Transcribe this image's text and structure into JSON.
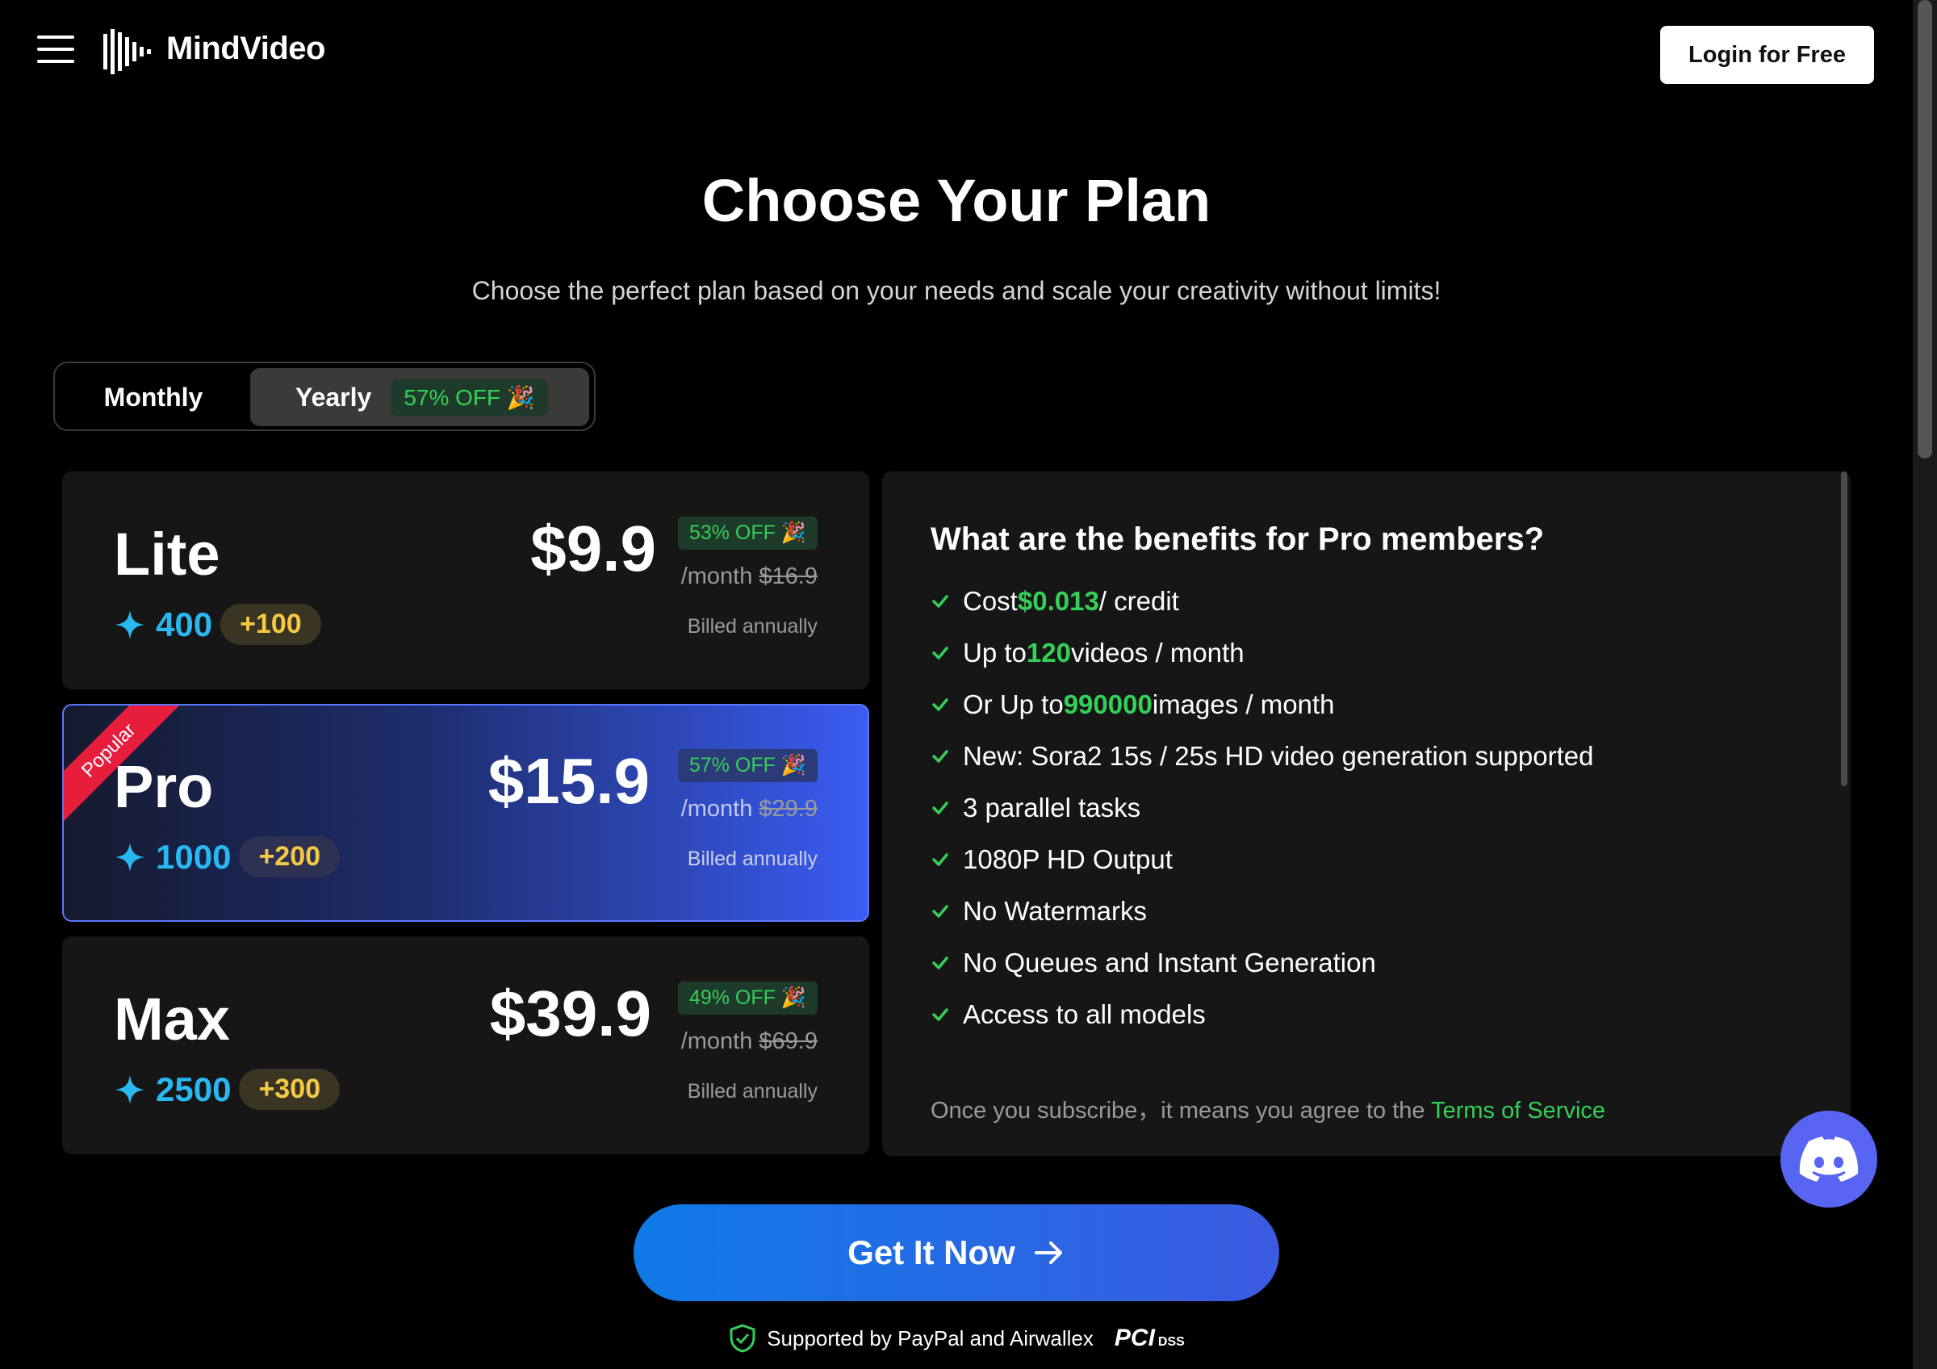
{
  "header": {
    "brand": "MindVideo",
    "login_label": "Login for Free"
  },
  "hero": {
    "title": "Choose Your Plan",
    "subtitle": "Choose the perfect plan based on your needs and scale your creativity without limits!"
  },
  "billing_toggle": {
    "monthly_label": "Monthly",
    "yearly_label": "Yearly",
    "yearly_badge": "57% OFF 🎉",
    "selected": "Yearly"
  },
  "plans": [
    {
      "name": "Lite",
      "credits": "400",
      "bonus": "+100",
      "price": "$9.9",
      "off": "53% OFF 🎉",
      "per": "/month",
      "old_price": "$16.9",
      "billed": "Billed annually"
    },
    {
      "name": "Pro",
      "credits": "1000",
      "bonus": "+200",
      "price": "$15.9",
      "off": "57% OFF 🎉",
      "per": "/month",
      "old_price": "$29.9",
      "billed": "Billed annually",
      "ribbon": "Popular"
    },
    {
      "name": "Max",
      "credits": "2500",
      "bonus": "+300",
      "price": "$39.9",
      "off": "49% OFF 🎉",
      "per": "/month",
      "old_price": "$69.9",
      "billed": "Billed annually"
    }
  ],
  "benefits": {
    "title": "What are the benefits for Pro members?",
    "items": [
      {
        "pre": "Cost ",
        "hl": "$0.013",
        "post": " / credit"
      },
      {
        "pre": "Up to ",
        "hl": "120",
        "post": " videos / month"
      },
      {
        "pre": "Or Up to ",
        "hl": "990000",
        "post": " images / month"
      },
      {
        "pre": "New: Sora2 15s / 25s HD video generation supported",
        "hl": "",
        "post": ""
      },
      {
        "pre": "3 parallel tasks",
        "hl": "",
        "post": ""
      },
      {
        "pre": "1080P HD Output",
        "hl": "",
        "post": ""
      },
      {
        "pre": "No Watermarks",
        "hl": "",
        "post": ""
      },
      {
        "pre": "No Queues and Instant Generation",
        "hl": "",
        "post": ""
      },
      {
        "pre": "Access to all models",
        "hl": "",
        "post": ""
      }
    ],
    "terms_text": "Once you subscribe，it means you agree to the ",
    "terms_link": "Terms of Service"
  },
  "cta": {
    "label": "Get It Now"
  },
  "support": {
    "text": "Supported by PayPal and Airwallex",
    "pci": "PCI",
    "pci_sub": "DSS"
  },
  "colors": {
    "accent_green": "#34d058",
    "accent_blue": "#2ab8f2",
    "cta_blue": "#0f7ae6",
    "discord": "#5865f2"
  }
}
